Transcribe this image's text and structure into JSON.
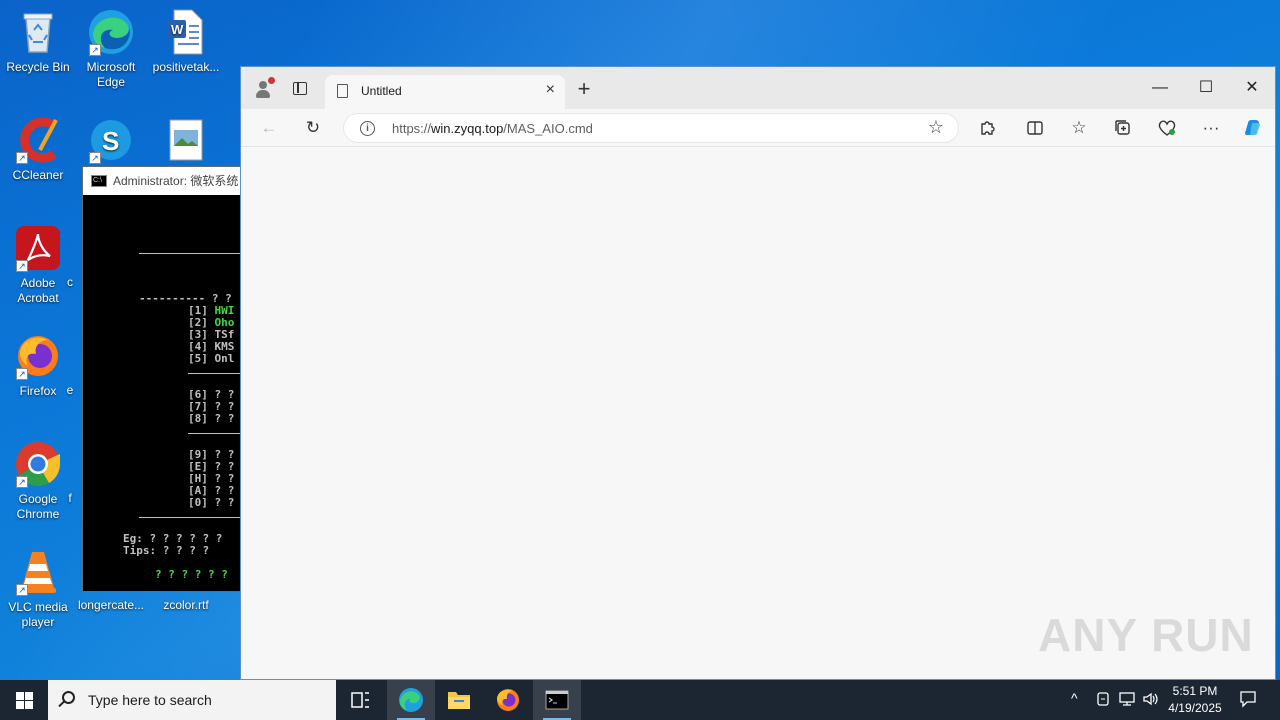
{
  "desktop": {
    "icons": [
      {
        "label": "Recycle Bin"
      },
      {
        "label": "Microsoft Edge"
      },
      {
        "label": "positivetak..."
      },
      {
        "label": "CCleaner"
      },
      {
        "label": "Adobe Acrobat"
      },
      {
        "label": "Firefox"
      },
      {
        "label": "Google Chrome"
      },
      {
        "label": "VLC media player"
      },
      {
        "label": "longercate..."
      },
      {
        "label": "zcolor.rtf"
      }
    ],
    "partial_labels": [
      "c",
      "e",
      "f"
    ]
  },
  "cmd": {
    "title": "Administrator:  微软系统",
    "lines": {
      "header": "---------- ? ?",
      "opt1_key": "[1] ",
      "opt1_text": "HWI",
      "opt2_key": "[2] ",
      "opt2_text": "Oho",
      "opt3": "[3] TSf",
      "opt4": "[4] KMS",
      "opt5": "[5] Onl",
      "opt6": "[6] ? ?",
      "opt7": "[7] ? ?",
      "opt8": "[8] ? ?",
      "opt9": "[9] ? ?",
      "optE": "[E] ? ?",
      "optH": "[H] ? ?",
      "optA": "[A] ? ?",
      "opt0": "[0] ? ?",
      "eg": "Eg: ? ? ? ? ? ?",
      "tips": "Tips: ? ? ? ?",
      "prompt": "? ? ? ? ? ?"
    }
  },
  "browser": {
    "tab_title": "Untitled",
    "url_scheme": "https://",
    "url_host": "win.zyqq.top",
    "url_path": "/MAS_AIO.cmd",
    "window_buttons": {
      "minimize": "—",
      "maximize": "☐",
      "close": "✕"
    }
  },
  "watermark": "ANY RUN",
  "taskbar": {
    "search_placeholder": "Type here to search",
    "time": "5:51 PM",
    "date": "4/19/2025"
  },
  "colors": {
    "desktop": "#0b78d8",
    "taskbar": "#1c2633",
    "cmd_green": "#3ddc3d",
    "edge_accent": "#0c7bd6"
  }
}
